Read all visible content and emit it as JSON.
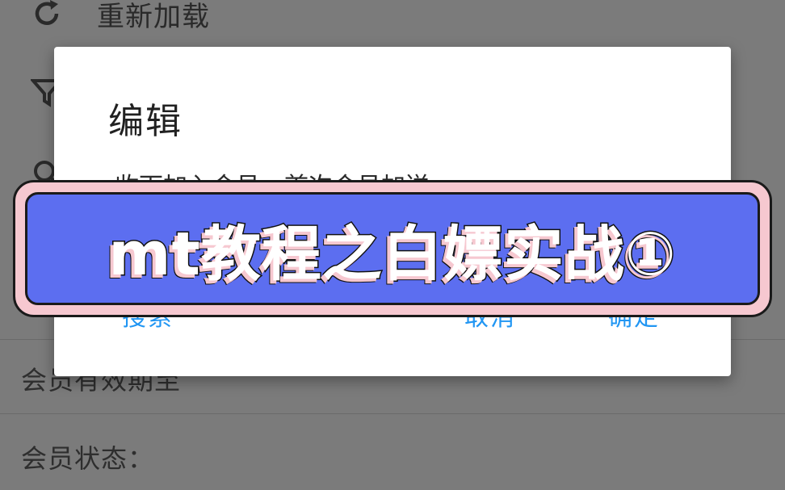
{
  "background_menu": {
    "items": [
      {
        "label": "重新加载",
        "icon": "reload-icon"
      },
      {
        "label": "",
        "icon": "filter-icon"
      },
      {
        "label": "",
        "icon": "search-icon"
      }
    ],
    "info_rows": [
      {
        "label": "会员有效期至"
      },
      {
        "label": "会员状态："
      }
    ]
  },
  "dialog": {
    "title": "编辑",
    "hint": "收下加入会员，首次会员加送",
    "buttons": {
      "search": "搜索",
      "cancel": "取消",
      "confirm": "确定"
    }
  },
  "caption": {
    "text": "mt教程之白嫖实战①"
  },
  "colors": {
    "accent": "#2196f3",
    "banner_fill": "#5c6ef0",
    "banner_outline": "#f6c8d0",
    "scrim": "#7b7b7b"
  }
}
